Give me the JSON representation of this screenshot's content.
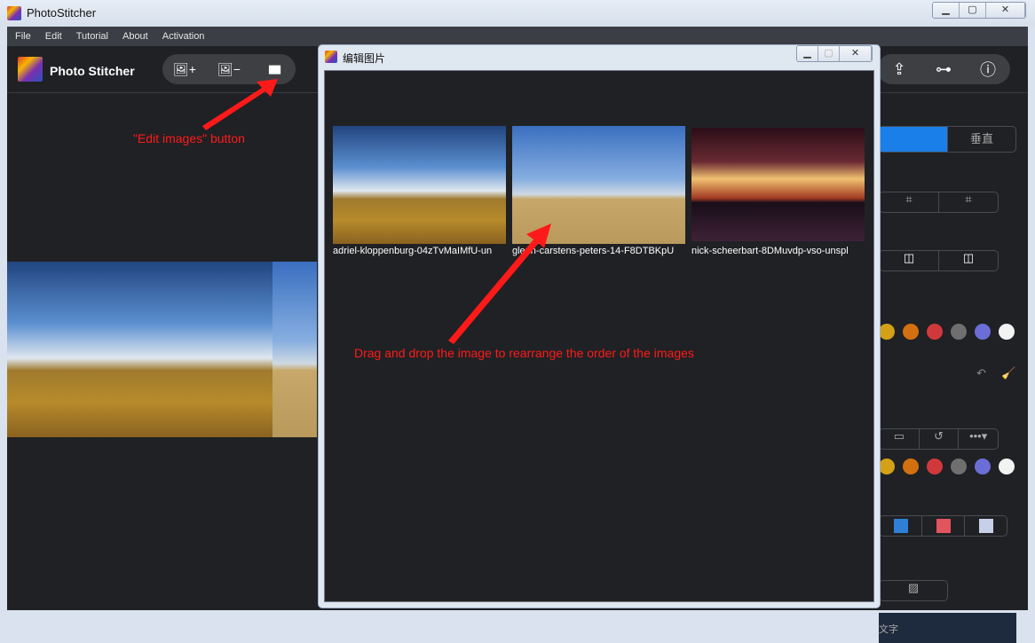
{
  "window": {
    "title": "PhotoStitcher",
    "controls": [
      "minimize",
      "maximize",
      "close"
    ]
  },
  "menu": [
    "File",
    "Edit",
    "Tutorial",
    "About",
    "Activation"
  ],
  "app": {
    "brand": "Photo Stitcher",
    "toolbar_left": [
      {
        "icon": "add-image-icon",
        "label": "🖼+"
      },
      {
        "icon": "remove-image-icon",
        "label": "🖼−"
      },
      {
        "icon": "edit-images-icon",
        "label": "▮▮▮"
      }
    ],
    "toolbar_right": [
      {
        "icon": "upload-cloud-icon",
        "label": "⇪"
      },
      {
        "icon": "key-icon",
        "label": "⊶"
      },
      {
        "icon": "info-icon",
        "label": "ⓘ"
      }
    ]
  },
  "annotations": {
    "edit_images": "\"Edit images\" button",
    "drag": "Drag and drop the image to rearrange the order of the images",
    "color": "#ff1a1a"
  },
  "right_panel": {
    "orientation_selected": "",
    "orientation_vertical": "垂直",
    "text_placeholder": "文字",
    "colors": [
      "#d4a017",
      "#d2700f",
      "#d0393c",
      "#6f6f6f",
      "#6a6ed6",
      "#f2f2f2",
      "#3fbf2a"
    ],
    "accent": "#1a7fe8"
  },
  "dialog": {
    "title": "编辑图片",
    "controls": [
      "minimize",
      "maximize",
      "close"
    ],
    "images": [
      {
        "caption": "adriel-kloppenburg-04zTvMaIMfU-un"
      },
      {
        "caption": "glenn-carstens-peters-14-F8DTBKpU"
      },
      {
        "caption": "nick-scheerbart-8DMuvdp-vso-unspl"
      }
    ]
  }
}
